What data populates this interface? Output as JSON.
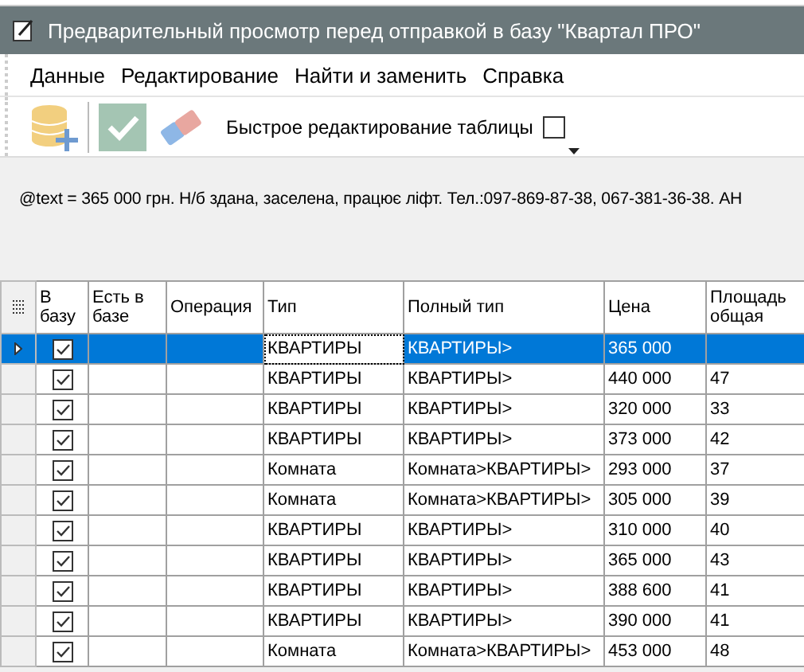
{
  "window": {
    "title": "Предварительный просмотр перед отправкой в базу \"Квартал ПРО\""
  },
  "menu": [
    {
      "label": "Данные"
    },
    {
      "label": "Редактирование"
    },
    {
      "label": "Найти и заменить"
    },
    {
      "label": "Справка"
    }
  ],
  "toolbar": {
    "quick_edit_label": "Быстрое редактирование таблицы",
    "quick_edit_checked": false
  },
  "info_text": "@text = 365 000 грн. Н/б здана, заселена, працює ліфт. Тел.:097-869-87-38, 067-381-36-38. АН",
  "table": {
    "columns": [
      {
        "kind": "checkbox",
        "label": "В базу"
      },
      {
        "kind": "blank",
        "label": "Есть в базе"
      },
      {
        "kind": "blank",
        "label": "Операция"
      },
      {
        "kind": "text",
        "label": "Тип"
      },
      {
        "kind": "text",
        "label": "Полный тип"
      },
      {
        "kind": "text",
        "label": "Цена"
      },
      {
        "kind": "text",
        "label": "Площадь общая"
      }
    ],
    "rows": [
      {
        "selected": true,
        "checked": true,
        "cells": [
          "",
          "",
          "",
          "КВАРТИРЫ",
          "КВАРТИРЫ>",
          "365 000",
          ""
        ]
      },
      {
        "selected": false,
        "checked": true,
        "cells": [
          "",
          "",
          "",
          "КВАРТИРЫ",
          "КВАРТИРЫ>",
          "440 000",
          "47"
        ]
      },
      {
        "selected": false,
        "checked": true,
        "cells": [
          "",
          "",
          "",
          "КВАРТИРЫ",
          "КВАРТИРЫ>",
          "320 000",
          "33"
        ]
      },
      {
        "selected": false,
        "checked": true,
        "cells": [
          "",
          "",
          "",
          "КВАРТИРЫ",
          "КВАРТИРЫ>",
          "373 000",
          "42"
        ]
      },
      {
        "selected": false,
        "checked": true,
        "cells": [
          "",
          "",
          "",
          "Комната",
          "Комната>КВАРТИРЫ>",
          "293 000",
          "37"
        ]
      },
      {
        "selected": false,
        "checked": true,
        "cells": [
          "",
          "",
          "",
          "Комната",
          "Комната>КВАРТИРЫ>",
          "305 000",
          "39"
        ]
      },
      {
        "selected": false,
        "checked": true,
        "cells": [
          "",
          "",
          "",
          "КВАРТИРЫ",
          "КВАРТИРЫ>",
          "310 000",
          "40"
        ]
      },
      {
        "selected": false,
        "checked": true,
        "cells": [
          "",
          "",
          "",
          "КВАРТИРЫ",
          "КВАРТИРЫ>",
          "365 000",
          "43"
        ]
      },
      {
        "selected": false,
        "checked": true,
        "cells": [
          "",
          "",
          "",
          "КВАРТИРЫ",
          "КВАРТИРЫ>",
          "388 600",
          "41"
        ]
      },
      {
        "selected": false,
        "checked": true,
        "cells": [
          "",
          "",
          "",
          "КВАРТИРЫ",
          "КВАРТИРЫ>",
          "390 000",
          "41"
        ]
      },
      {
        "selected": false,
        "checked": true,
        "cells": [
          "",
          "",
          "",
          "Комната",
          "Комната>КВАРТИРЫ>",
          "453 000",
          "48"
        ]
      }
    ]
  }
}
